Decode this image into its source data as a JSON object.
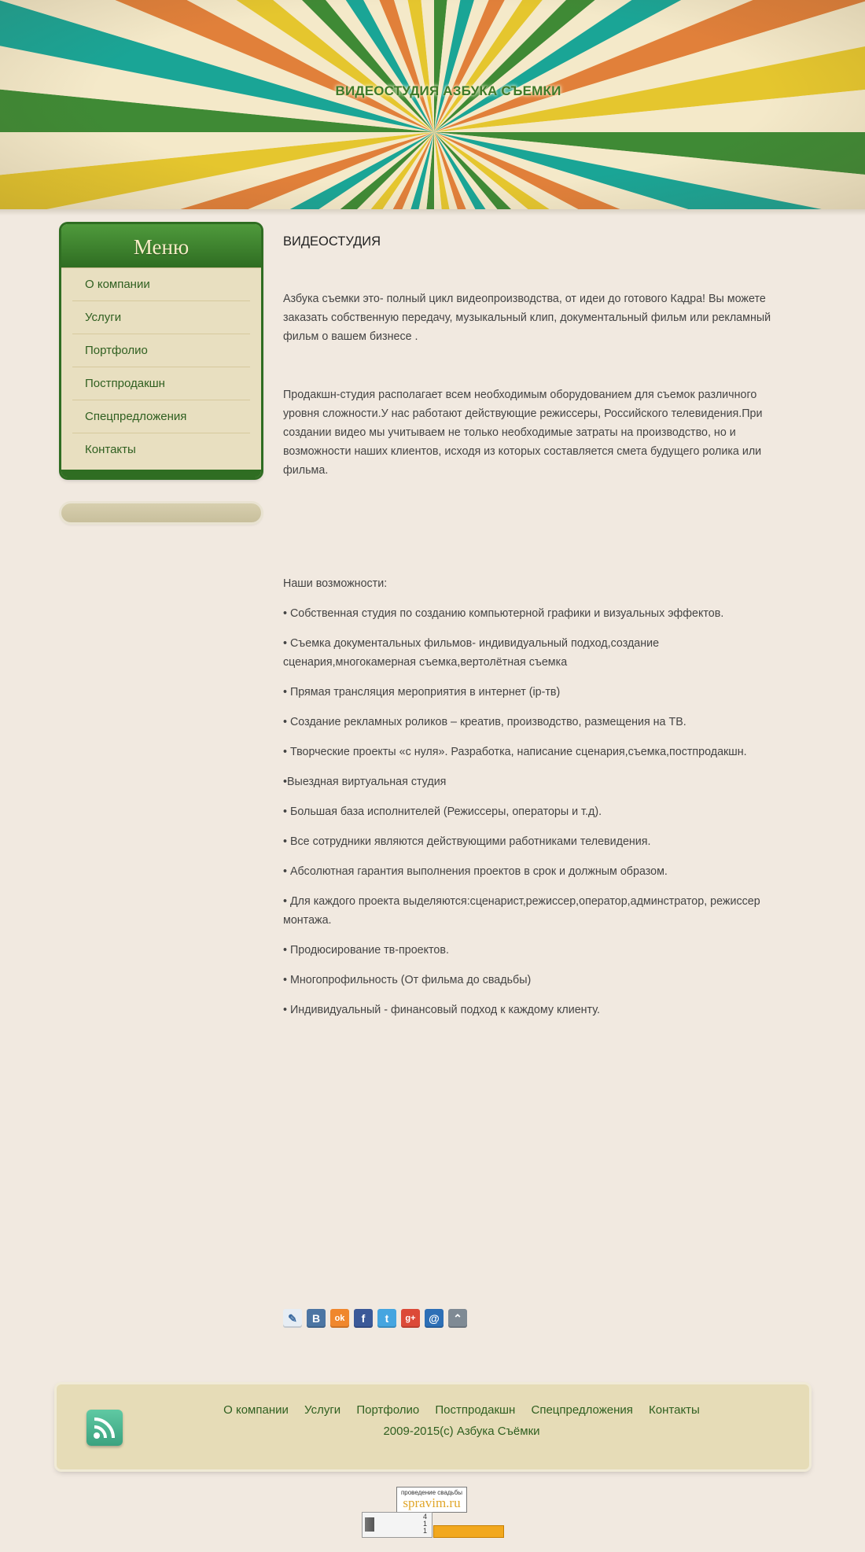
{
  "site": {
    "title": "ВИДЕОСТУДИЯ АЗБУКА СЪЕМКИ"
  },
  "menu": {
    "heading": "Меню",
    "items": [
      {
        "label": "О компании"
      },
      {
        "label": "Услуги"
      },
      {
        "label": "Портфолио"
      },
      {
        "label": "Постпродакшн"
      },
      {
        "label": "Спецпредложения"
      },
      {
        "label": "Контакты"
      }
    ]
  },
  "content": {
    "heading": "ВИДЕОСТУДИЯ",
    "paragraph1": "  Азбука съемки это- полный цикл видеопроизводства, от идеи до готового Кадра!  Вы можете заказать собственную передачу, музыкальный клип, документальный фильм или рекламный фильм о вашем бизнесе .",
    "paragraph2": "Продакшн-студия располагает всем необходимым оборудованием для съемок различного уровня сложности.У нас работают действующие режиссеры, Российского телевидения.При создании видео мы учитываем не только необходимые затраты на производство, но и возможности наших клиентов, исходя из которых составляется смета будущего ролика или фильма.",
    "capabilities_title": "Наши возможности:",
    "capabilities": [
      "• Собственная студия по созданию компьютерной графики и визуальных эффектов.",
      "• Съемка документальных фильмов- индивидуальный подход,создание сценария,многокамерная  съемка,вертолётная съемка",
      "• Прямая трансляция  мероприятия в интернет  (ip-тв)",
      "• Создание рекламных роликов – креатив, производство, размещения на ТВ.",
      "• Творческие проекты «с нуля». Разработка, написание сценария,съемка,постпродакшн.",
      " •Выездная виртуальная студия",
      "• Большая база исполнителей (Режиссеры, операторы и т.д).",
      "• Все сотрудники являются действующими работниками телевидения.",
      "• Абсолютная гарантия выполнения проектов в срок и должным образом.",
      "• Для каждого проекта выделяются:сценарист,режиссер,оператор,админстратор, режиссер монтажа.",
      "• Продюсирование тв-проектов.",
      "• Многопрофильность (От фильма до свадьбы)",
      "• Индивидуальный - финансовый подход  к каждому клиенту."
    ]
  },
  "share": {
    "buttons": [
      {
        "icon": "livejournal-icon",
        "glyph": "✎",
        "color": "#e6edf4"
      },
      {
        "icon": "vkontakte-icon",
        "glyph": "В",
        "color": "#4c75a3"
      },
      {
        "icon": "odnoklassniki-icon",
        "glyph": "ok",
        "color": "#f0872d"
      },
      {
        "icon": "facebook-icon",
        "glyph": "f",
        "color": "#3b5998"
      },
      {
        "icon": "twitter-icon",
        "glyph": "t",
        "color": "#45a5e0"
      },
      {
        "icon": "google-plus-icon",
        "glyph": "g+",
        "color": "#dc4a38"
      },
      {
        "icon": "mail-icon",
        "glyph": "@",
        "color": "#2d6fb6"
      },
      {
        "icon": "more-icon",
        "glyph": "⌃",
        "color": "#7f8a94"
      }
    ]
  },
  "footer": {
    "nav": [
      {
        "label": "О компании"
      },
      {
        "label": "Услуги"
      },
      {
        "label": "Портфолио"
      },
      {
        "label": "Постпродакшн"
      },
      {
        "label": "Спецпредложения"
      },
      {
        "label": "Контакты"
      }
    ],
    "copyright": "2009-2015(c) Азбука Съёмки",
    "rss_icon": "rss-icon"
  },
  "badges": {
    "badge1_line1": "проведение свадьбы",
    "badge1_line2": "spravim.ru",
    "counter_lines": [
      "4",
      "1",
      "1"
    ]
  },
  "colors": {
    "accent_green": "#2f6d22",
    "link_green": "#2f5f20",
    "ray_green": "#3f8a35",
    "ray_teal": "#1aa596",
    "ray_orange": "#e1803a",
    "ray_yellow": "#e5c62e",
    "ray_cream": "#f4e9c9"
  }
}
